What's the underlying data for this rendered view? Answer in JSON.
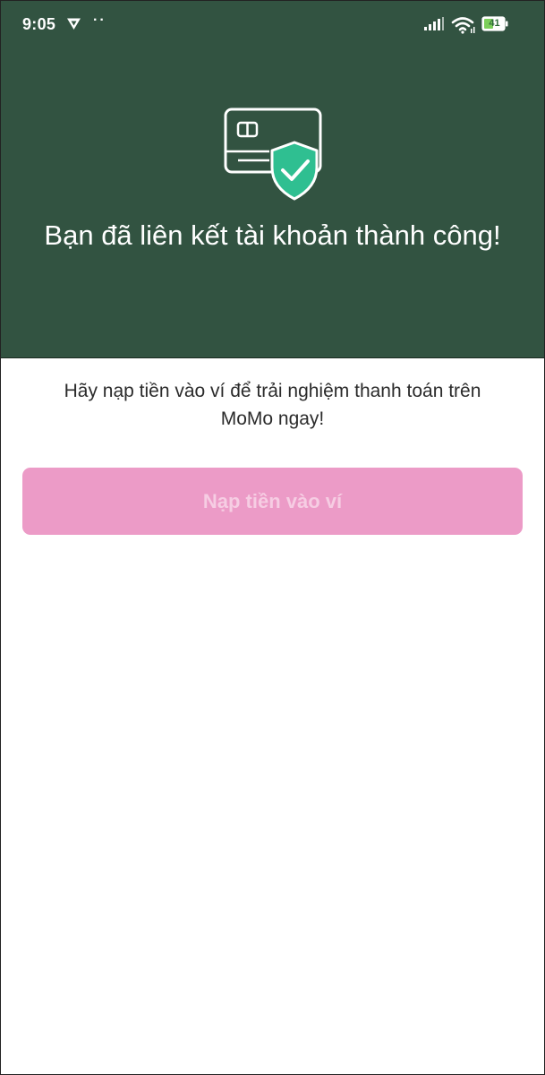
{
  "status_bar": {
    "time": "9:05",
    "dots": "··",
    "battery_level": "41",
    "vpn_icon": "shield-icon",
    "signal_icon": "signal-bars-icon",
    "wifi_icon": "wifi-icon",
    "battery_icon": "battery-icon"
  },
  "hero": {
    "title": "Bạn đã liên kết tài khoản thành công!",
    "illustration_icon": "card-shield-check-icon"
  },
  "main": {
    "prompt": "Hãy nạp tiền vào ví để trải nghiệm thanh toán trên MoMo ngay!",
    "topup_button_label": "Nạp tiền vào ví"
  },
  "colors": {
    "hero_background": "#325341",
    "shield_accent": "#2fbf91",
    "button_background": "#ec9bc7",
    "button_text": "#f6cde3",
    "text": "#2b2b2b"
  }
}
